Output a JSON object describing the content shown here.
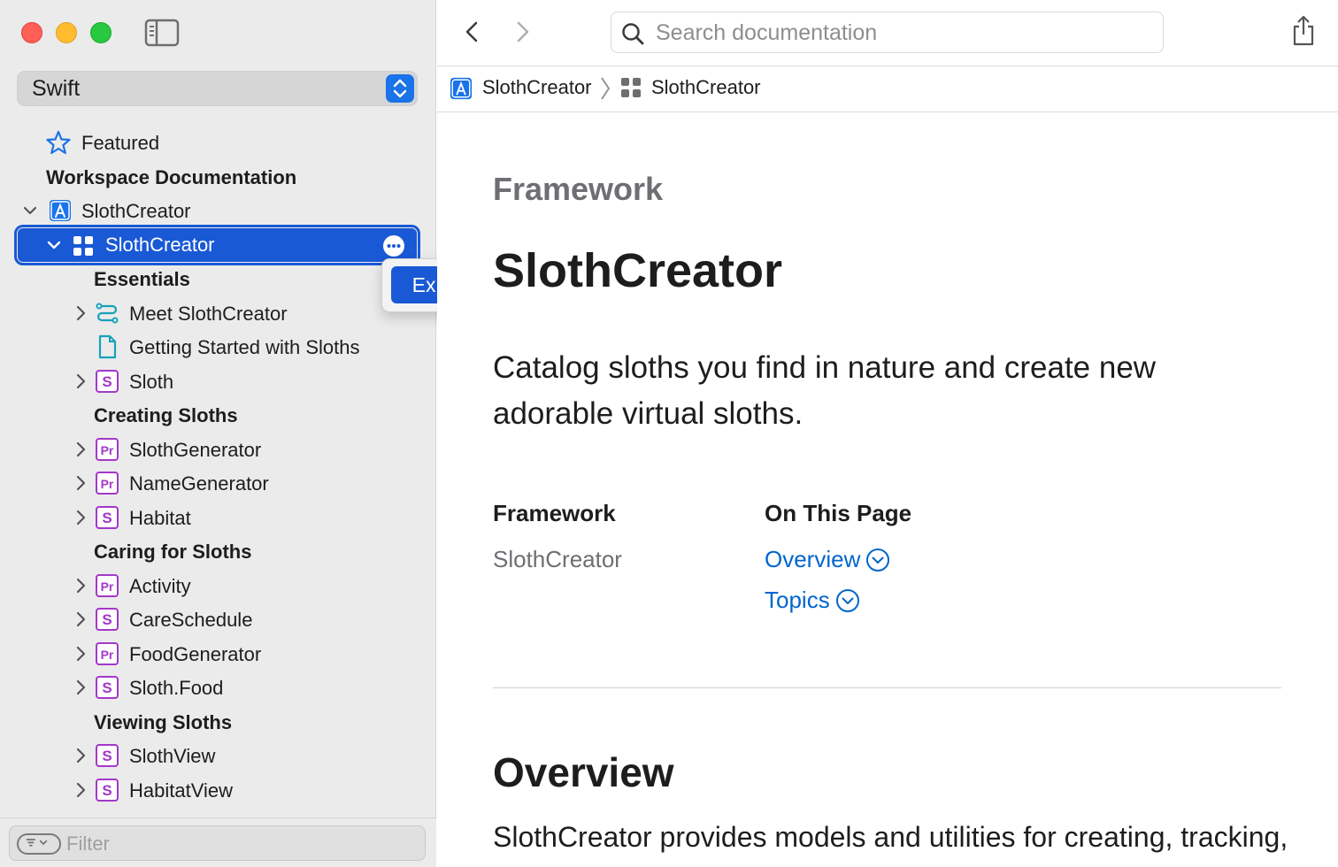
{
  "window": {
    "traffic_lights": [
      "close",
      "minimize",
      "zoom"
    ]
  },
  "sidebar": {
    "language": "Swift",
    "featured_label": "Featured",
    "workspace_heading": "Workspace Documentation",
    "project_label": "SlothCreator",
    "selected_label": "SlothCreator",
    "export_label": "Export...",
    "sections": [
      {
        "heading": "Essentials",
        "items": [
          {
            "label": "Meet SlothCreator",
            "kind": "tutorial",
            "expandable": true
          },
          {
            "label": "Getting Started with Sloths",
            "kind": "article",
            "expandable": false
          },
          {
            "label": "Sloth",
            "kind": "S",
            "expandable": true
          }
        ]
      },
      {
        "heading": "Creating Sloths",
        "items": [
          {
            "label": "SlothGenerator",
            "kind": "Pr",
            "expandable": true
          },
          {
            "label": "NameGenerator",
            "kind": "Pr",
            "expandable": true
          },
          {
            "label": "Habitat",
            "kind": "S",
            "expandable": true
          }
        ]
      },
      {
        "heading": "Caring for Sloths",
        "items": [
          {
            "label": "Activity",
            "kind": "Pr",
            "expandable": true
          },
          {
            "label": "CareSchedule",
            "kind": "S",
            "expandable": true
          },
          {
            "label": "FoodGenerator",
            "kind": "Pr",
            "expandable": true
          },
          {
            "label": "Sloth.Food",
            "kind": "S",
            "expandable": true
          }
        ]
      },
      {
        "heading": "Viewing Sloths",
        "items": [
          {
            "label": "SlothView",
            "kind": "S",
            "expandable": true
          },
          {
            "label": "HabitatView",
            "kind": "S",
            "expandable": true
          }
        ]
      }
    ],
    "filter_placeholder": "Filter"
  },
  "toolbar": {
    "search_placeholder": "Search documentation"
  },
  "breadcrumb": {
    "items": [
      "SlothCreator",
      "SlothCreator"
    ]
  },
  "content": {
    "eyebrow": "Framework",
    "title": "SlothCreator",
    "abstract": "Catalog sloths you find in nature and create new adorable virtual sloths.",
    "framework_heading": "Framework",
    "framework_value": "SlothCreator",
    "on_this_page_heading": "On This Page",
    "on_this_page_links": [
      "Overview",
      "Topics"
    ],
    "overview_heading": "Overview",
    "overview_text": "SlothCreator provides models and utilities for creating, tracking,"
  },
  "colors": {
    "accent": "#1959d6",
    "symbol_purple": "#a438c9",
    "link": "#0066cc",
    "sidebar_bg": "#ebebeb"
  }
}
